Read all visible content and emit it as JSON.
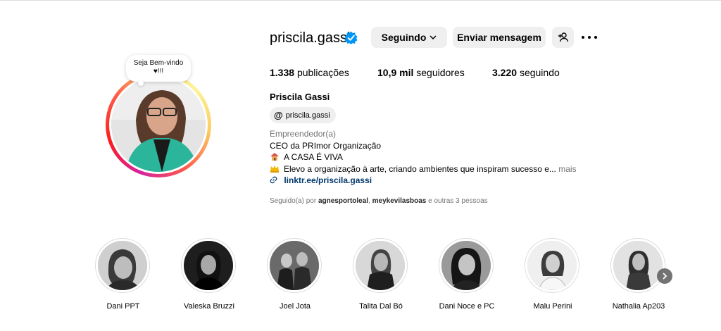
{
  "profile": {
    "username": "priscila.gassi",
    "verified_icon": "verified-badge-icon",
    "note_line1": "Seja Bem-vindo",
    "note_line2": "♥!!!",
    "buttons": {
      "following": "Seguindo",
      "message": "Enviar mensagem"
    },
    "stats": {
      "posts_value": "1.338",
      "posts_label": "publicações",
      "followers_value": "10,9 mil",
      "followers_label": "seguidores",
      "following_value": "3.220",
      "following_label": "seguindo"
    },
    "full_name": "Priscila Gassi",
    "threads_handle": "priscila.gassi",
    "category": "Empreendedor(a)",
    "bio": [
      "CEO da PRImor Organização",
      "A CASA É VIVA",
      "Elevo a organização à arte, criando ambientes que inspiram sucesso e..."
    ],
    "bio_more": "mais",
    "link": "linktr.ee/priscila.gassi",
    "followed_by_prefix": "Seguido(a) por",
    "followed_by_user1": "agnesportoleal",
    "followed_by_sep": ",",
    "followed_by_user2": "meykevilasboas",
    "followed_by_suffix": "e outras 3 pessoas"
  },
  "highlights": [
    {
      "label": "Dani PPT"
    },
    {
      "label": "Valeska Bruzzi"
    },
    {
      "label": "Joel Jota"
    },
    {
      "label": "Talita Dal Bó"
    },
    {
      "label": "Dani Noce e PC"
    },
    {
      "label": "Malu Perini"
    },
    {
      "label": "Nathalia Ap203"
    }
  ],
  "colors": {
    "verified": "#0095f6",
    "link": "#00376b",
    "button_bg": "#efefef",
    "muted": "#737373"
  }
}
